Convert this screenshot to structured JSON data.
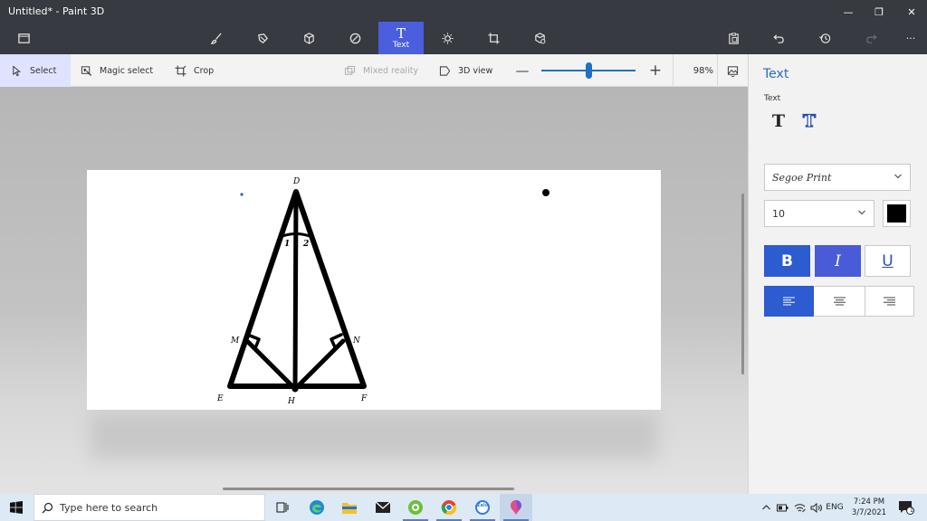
{
  "window": {
    "title": "Untitled* - Paint 3D",
    "minimize": "—",
    "restore": "❐",
    "close": "✕"
  },
  "command_bar": {
    "menu_icon": "folder-icon",
    "tools": [
      {
        "name": "brushes",
        "icon": "brush-icon"
      },
      {
        "name": "2d-shapes",
        "icon": "shapes-2d-icon"
      },
      {
        "name": "3d-shapes",
        "icon": "cube-icon"
      },
      {
        "name": "stickers",
        "icon": "sticker-icon"
      },
      {
        "name": "text",
        "icon": "text-icon",
        "label": "Text",
        "glyph": "T",
        "active": true
      },
      {
        "name": "effects",
        "icon": "sun-icon"
      },
      {
        "name": "canvas",
        "icon": "canvas-icon"
      },
      {
        "name": "3d-library",
        "icon": "library-icon"
      }
    ],
    "right_icons": [
      "paste-icon",
      "undo-icon",
      "history-icon",
      "redo-icon",
      "more-icon"
    ],
    "more": "···",
    "accent": "#4b5ede"
  },
  "toolbar": {
    "select": "Select",
    "magic_select": "Magic select",
    "crop": "Crop",
    "mixed_reality": "Mixed reality",
    "view_3d": "3D view",
    "zoom_out": "—",
    "zoom_in": "+",
    "zoom_level": "98%",
    "zoom_fraction": 0.5
  },
  "canvas_labels": {
    "top": "D",
    "left_foot": "M",
    "right_foot": "N",
    "base_left": "E",
    "base_mid": "H",
    "base_right": "F",
    "angle_left": "1",
    "angle_right": "2"
  },
  "panel": {
    "title": "Text",
    "subtitle": "Text",
    "text_2d": "T",
    "text_3d": "T",
    "font": "Segoe Print",
    "size": "10",
    "color": "#000000",
    "bold": "B",
    "italic": "I",
    "underline": "U",
    "align_active": "left"
  },
  "taskbar": {
    "search_placeholder": "Type here to search",
    "apps": [
      "task-view-icon",
      "edge-icon",
      "file-explorer-icon",
      "mail-icon",
      "coccoc-icon",
      "chrome-icon",
      "zalo-icon",
      "paint3d-icon"
    ],
    "zalo": "Zalo",
    "language": "ENG",
    "time": "7:24 PM",
    "date": "3/7/2021",
    "notification_count": "1"
  }
}
